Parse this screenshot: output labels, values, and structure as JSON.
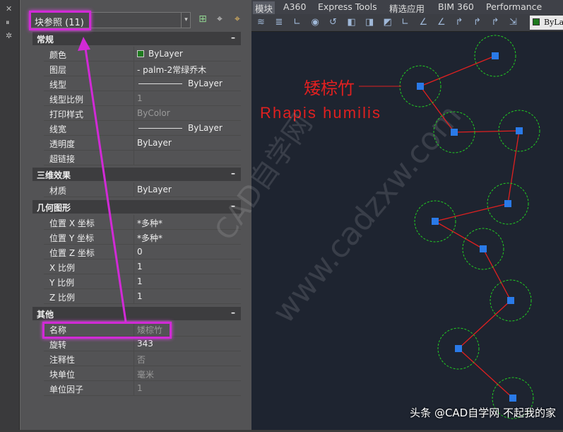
{
  "palette": {
    "close": "✕",
    "pin": "⏸",
    "settings": "✲"
  },
  "selector": {
    "value": "块参照 (11)",
    "arrow": "▾"
  },
  "toolbar": {
    "add": "⊞",
    "pick": "⌖",
    "quick": "⌖"
  },
  "sections": {
    "general": {
      "title": "常规",
      "collapse": "–",
      "rows": [
        {
          "k": "颜色",
          "v": "ByLayer"
        },
        {
          "k": "图层",
          "v": "- palm-2常绿乔木"
        },
        {
          "k": "线型",
          "v": "ByLayer"
        },
        {
          "k": "线型比例",
          "v": "1"
        },
        {
          "k": "打印样式",
          "v": "ByColor"
        },
        {
          "k": "线宽",
          "v": "ByLayer"
        },
        {
          "k": "透明度",
          "v": "ByLayer"
        },
        {
          "k": "超链接",
          "v": ""
        }
      ]
    },
    "3d": {
      "title": "三维效果",
      "collapse": "–",
      "rows": [
        {
          "k": "材质",
          "v": "ByLayer"
        }
      ]
    },
    "geometry": {
      "title": "几何图形",
      "collapse": "–",
      "rows": [
        {
          "k": "位置 X 坐标",
          "v": "*多种*"
        },
        {
          "k": "位置 Y 坐标",
          "v": "*多种*"
        },
        {
          "k": "位置 Z 坐标",
          "v": "0"
        },
        {
          "k": "X 比例",
          "v": "1"
        },
        {
          "k": "Y 比例",
          "v": "1"
        },
        {
          "k": "Z 比例",
          "v": "1"
        }
      ]
    },
    "misc": {
      "title": "其他",
      "collapse": "–",
      "rows": [
        {
          "k": "名称",
          "v": "矮棕竹"
        },
        {
          "k": "旋转",
          "v": "343"
        },
        {
          "k": "注释性",
          "v": "否"
        },
        {
          "k": "块单位",
          "v": "毫米"
        },
        {
          "k": "单位因子",
          "v": "1"
        }
      ]
    }
  },
  "ribbon": {
    "tabs": [
      "模块",
      "A360",
      "Express Tools",
      "精选应用",
      "BIM 360",
      "Performance"
    ]
  },
  "layer_box": "ByLayer",
  "canvas": {
    "label_cn": "矮棕竹",
    "label_latin": "Rhapis humilis",
    "watermark1": "CAD自学网",
    "watermark2": "www.cadzxw.com"
  },
  "footer": "头条 @CAD自学网 不起我的家",
  "colors": {
    "highlight": "#d12ad6",
    "leader": "#e02020",
    "circle": "#22cc22",
    "marker": "#2a7ae8"
  }
}
